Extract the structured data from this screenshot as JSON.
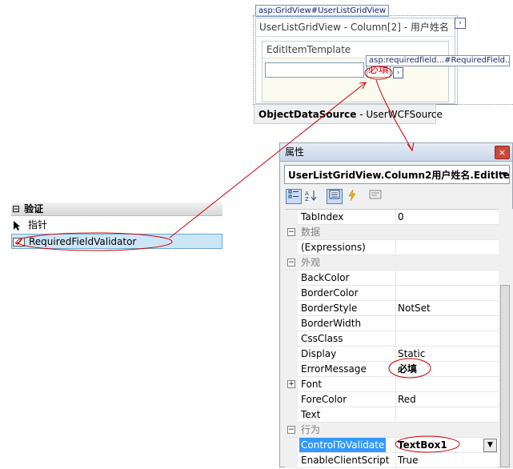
{
  "designer": {
    "gridview_tag": "asp:GridView#UserListGridView",
    "gridview_header": "UserListGridView - Column[2] - 用户姓名",
    "edit_template_title": "EditItemTemplate",
    "validator_tag": "asp:requiredfield...#RequiredField...",
    "validator_text": "必填",
    "objectdatasource_name": "ObjectDataSource",
    "objectdatasource_value": " - UserWCFSource",
    "smart_tag_glyph": "›"
  },
  "toolbox": {
    "section_label": "验证",
    "section_expander": "⊟",
    "items": [
      {
        "label": "指针",
        "icon": "pointer-icon"
      },
      {
        "label": "RequiredFieldValidator",
        "icon": "validator-icon"
      }
    ]
  },
  "properties": {
    "title": "属性",
    "close_glyph": "×",
    "object_selector": "UserListGridView.Column2用户姓名.EditIte",
    "dropdown_glyph": "▼",
    "rows": [
      {
        "type": "prop",
        "name": "TabIndex",
        "value": "0"
      },
      {
        "type": "cat",
        "name": "数据"
      },
      {
        "type": "prop",
        "name": "(Expressions)",
        "value": ""
      },
      {
        "type": "cat",
        "name": "外观"
      },
      {
        "type": "prop",
        "name": "BackColor",
        "value": ""
      },
      {
        "type": "prop",
        "name": "BorderColor",
        "value": ""
      },
      {
        "type": "prop",
        "name": "BorderStyle",
        "value": "NotSet"
      },
      {
        "type": "prop",
        "name": "BorderWidth",
        "value": ""
      },
      {
        "type": "prop",
        "name": "CssClass",
        "value": ""
      },
      {
        "type": "prop",
        "name": "Display",
        "value": "Static"
      },
      {
        "type": "prop",
        "name": "ErrorMessage",
        "value": "必填"
      },
      {
        "type": "prop",
        "name": "Font",
        "value": ""
      },
      {
        "type": "prop",
        "name": "ForeColor",
        "value": "Red"
      },
      {
        "type": "prop",
        "name": "Text",
        "value": ""
      },
      {
        "type": "cat",
        "name": "行为"
      },
      {
        "type": "prop",
        "name": "ControlToValidate",
        "value": "TextBox1"
      },
      {
        "type": "prop",
        "name": "EnableClientScript",
        "value": "True"
      }
    ]
  },
  "colors": {
    "annotation": "#cc0000",
    "validator_text": "#ff0000",
    "selection": "#3399ff"
  }
}
